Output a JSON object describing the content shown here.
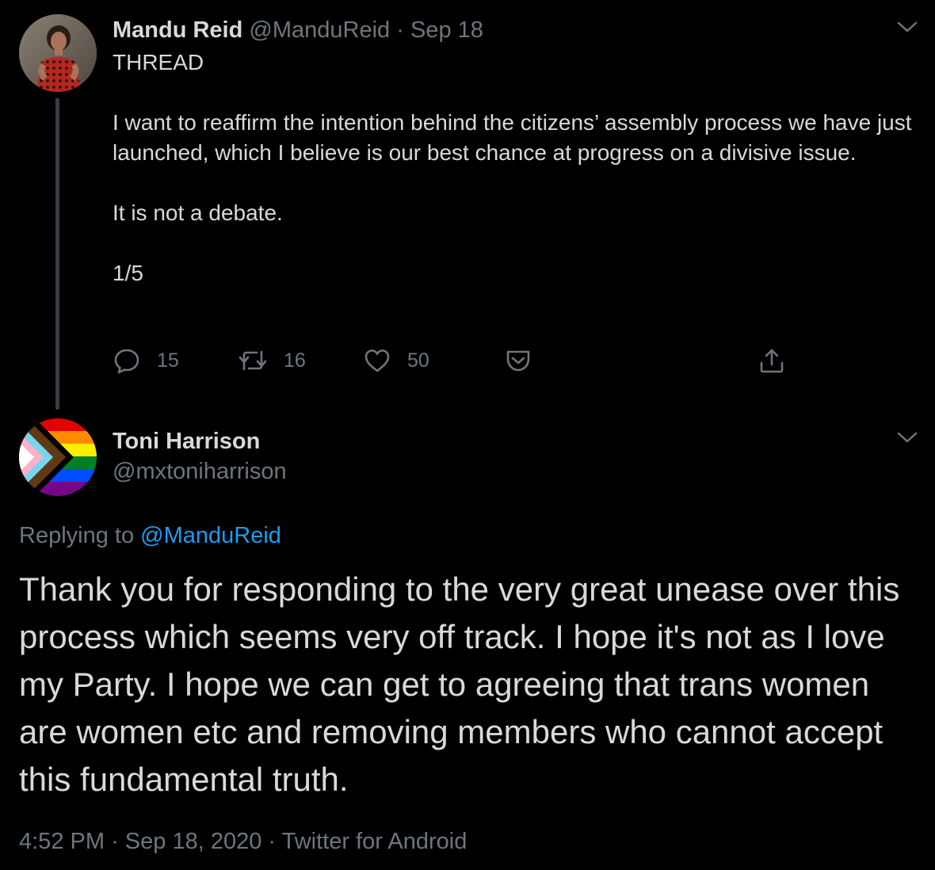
{
  "parent_tweet": {
    "author_name": "Mandu Reid",
    "author_handle": "@ManduReid",
    "separator": "·",
    "date": "Sep 18",
    "paragraphs": [
      "THREAD",
      "I want to reaffirm the intention behind the citizens’ assembly process we have just launched, which I believe is our best chance at progress on a divisive issue.",
      "It is not a debate.",
      "1/5"
    ],
    "actions": {
      "reply_count": "15",
      "retweet_count": "16",
      "like_count": "50"
    },
    "icons": {
      "menu": "chevron-down-icon",
      "reply": "speech-bubble-icon",
      "retweet": "retweet-icon",
      "like": "heart-icon",
      "bookmark": "pocket-save-icon",
      "share": "share-upload-icon"
    }
  },
  "reply_tweet": {
    "author_name": "Toni Harrison",
    "author_handle": "@mxtoniharrison",
    "replying_prefix": "Replying to",
    "replying_to": "@ManduReid",
    "text": "Thank you for responding to the very great unease over this process which seems very off track. I hope it's not as I love my Party. I hope we can get to agreeing that trans women are women etc and removing members who cannot accept this fundamental truth.",
    "time": "4:52 PM",
    "separator": "·",
    "date": "Sep 18, 2020",
    "source": "Twitter for Android",
    "icons": {
      "menu": "chevron-down-icon"
    }
  },
  "colors": {
    "background": "#000000",
    "text_primary": "#d9d9d9",
    "text_secondary": "#6e767d",
    "link": "#1d9bf0",
    "thread_line": "#3a3d41"
  }
}
